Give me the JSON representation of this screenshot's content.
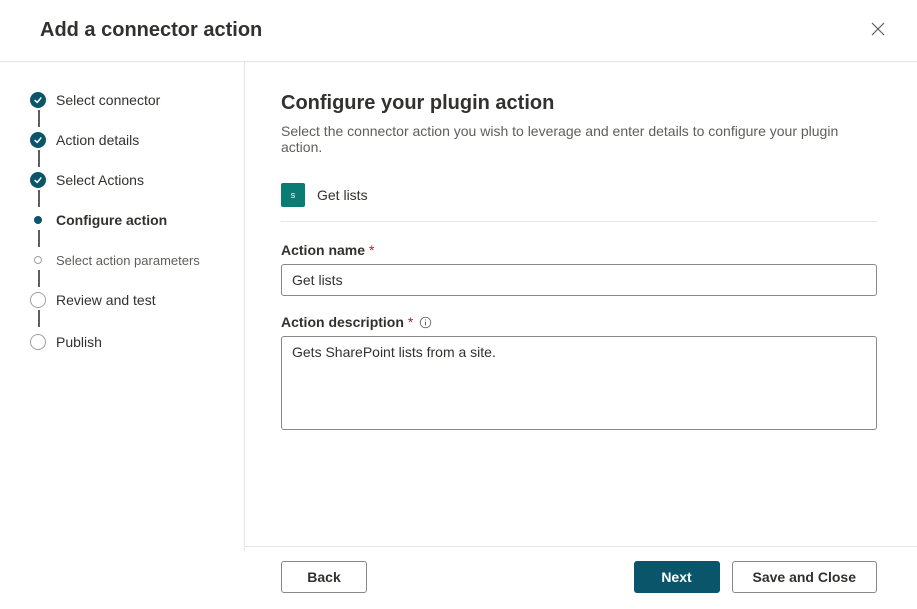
{
  "header": {
    "title": "Add a connector action"
  },
  "steps": [
    {
      "label": "Select connector",
      "state": "done"
    },
    {
      "label": "Action details",
      "state": "done"
    },
    {
      "label": "Select Actions",
      "state": "done"
    },
    {
      "label": "Configure action",
      "state": "current"
    },
    {
      "label": "Select action parameters",
      "state": "upcoming-small",
      "sub": true
    },
    {
      "label": "Review and test",
      "state": "upcoming-ring"
    },
    {
      "label": "Publish",
      "state": "upcoming-ring"
    }
  ],
  "main": {
    "title": "Configure your plugin action",
    "subtitle": "Select the connector action you wish to leverage and enter details to configure your plugin action.",
    "action_icon_text": "s",
    "action_label": "Get lists",
    "name_label": "Action name",
    "name_value": "Get lists",
    "description_label": "Action description",
    "description_value": "Gets SharePoint lists from a site."
  },
  "footer": {
    "back": "Back",
    "next": "Next",
    "save_close": "Save and Close"
  }
}
